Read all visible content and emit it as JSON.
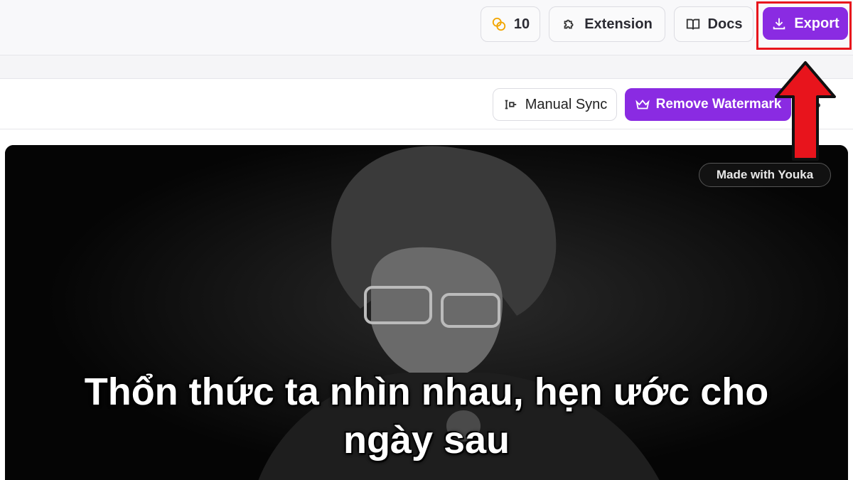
{
  "header": {
    "credits_count": "10",
    "extension_label": "Extension",
    "docs_label": "Docs",
    "export_label": "Export"
  },
  "toolbar": {
    "manual_sync_label": "Manual Sync",
    "remove_watermark_label": "Remove Watermark"
  },
  "preview": {
    "badge_text": "Made with Youka",
    "lyric_line1": "Thổn thức ta nhìn nhau, hẹn ước cho",
    "lyric_line2": "ngày sau"
  },
  "colors": {
    "accent": "#8a2be2",
    "highlight": "#e8141c",
    "coin": "#f2a500"
  },
  "icons": [
    "coins-icon",
    "puzzle-icon",
    "book-icon",
    "download-icon",
    "sync-icon",
    "crown-icon"
  ]
}
